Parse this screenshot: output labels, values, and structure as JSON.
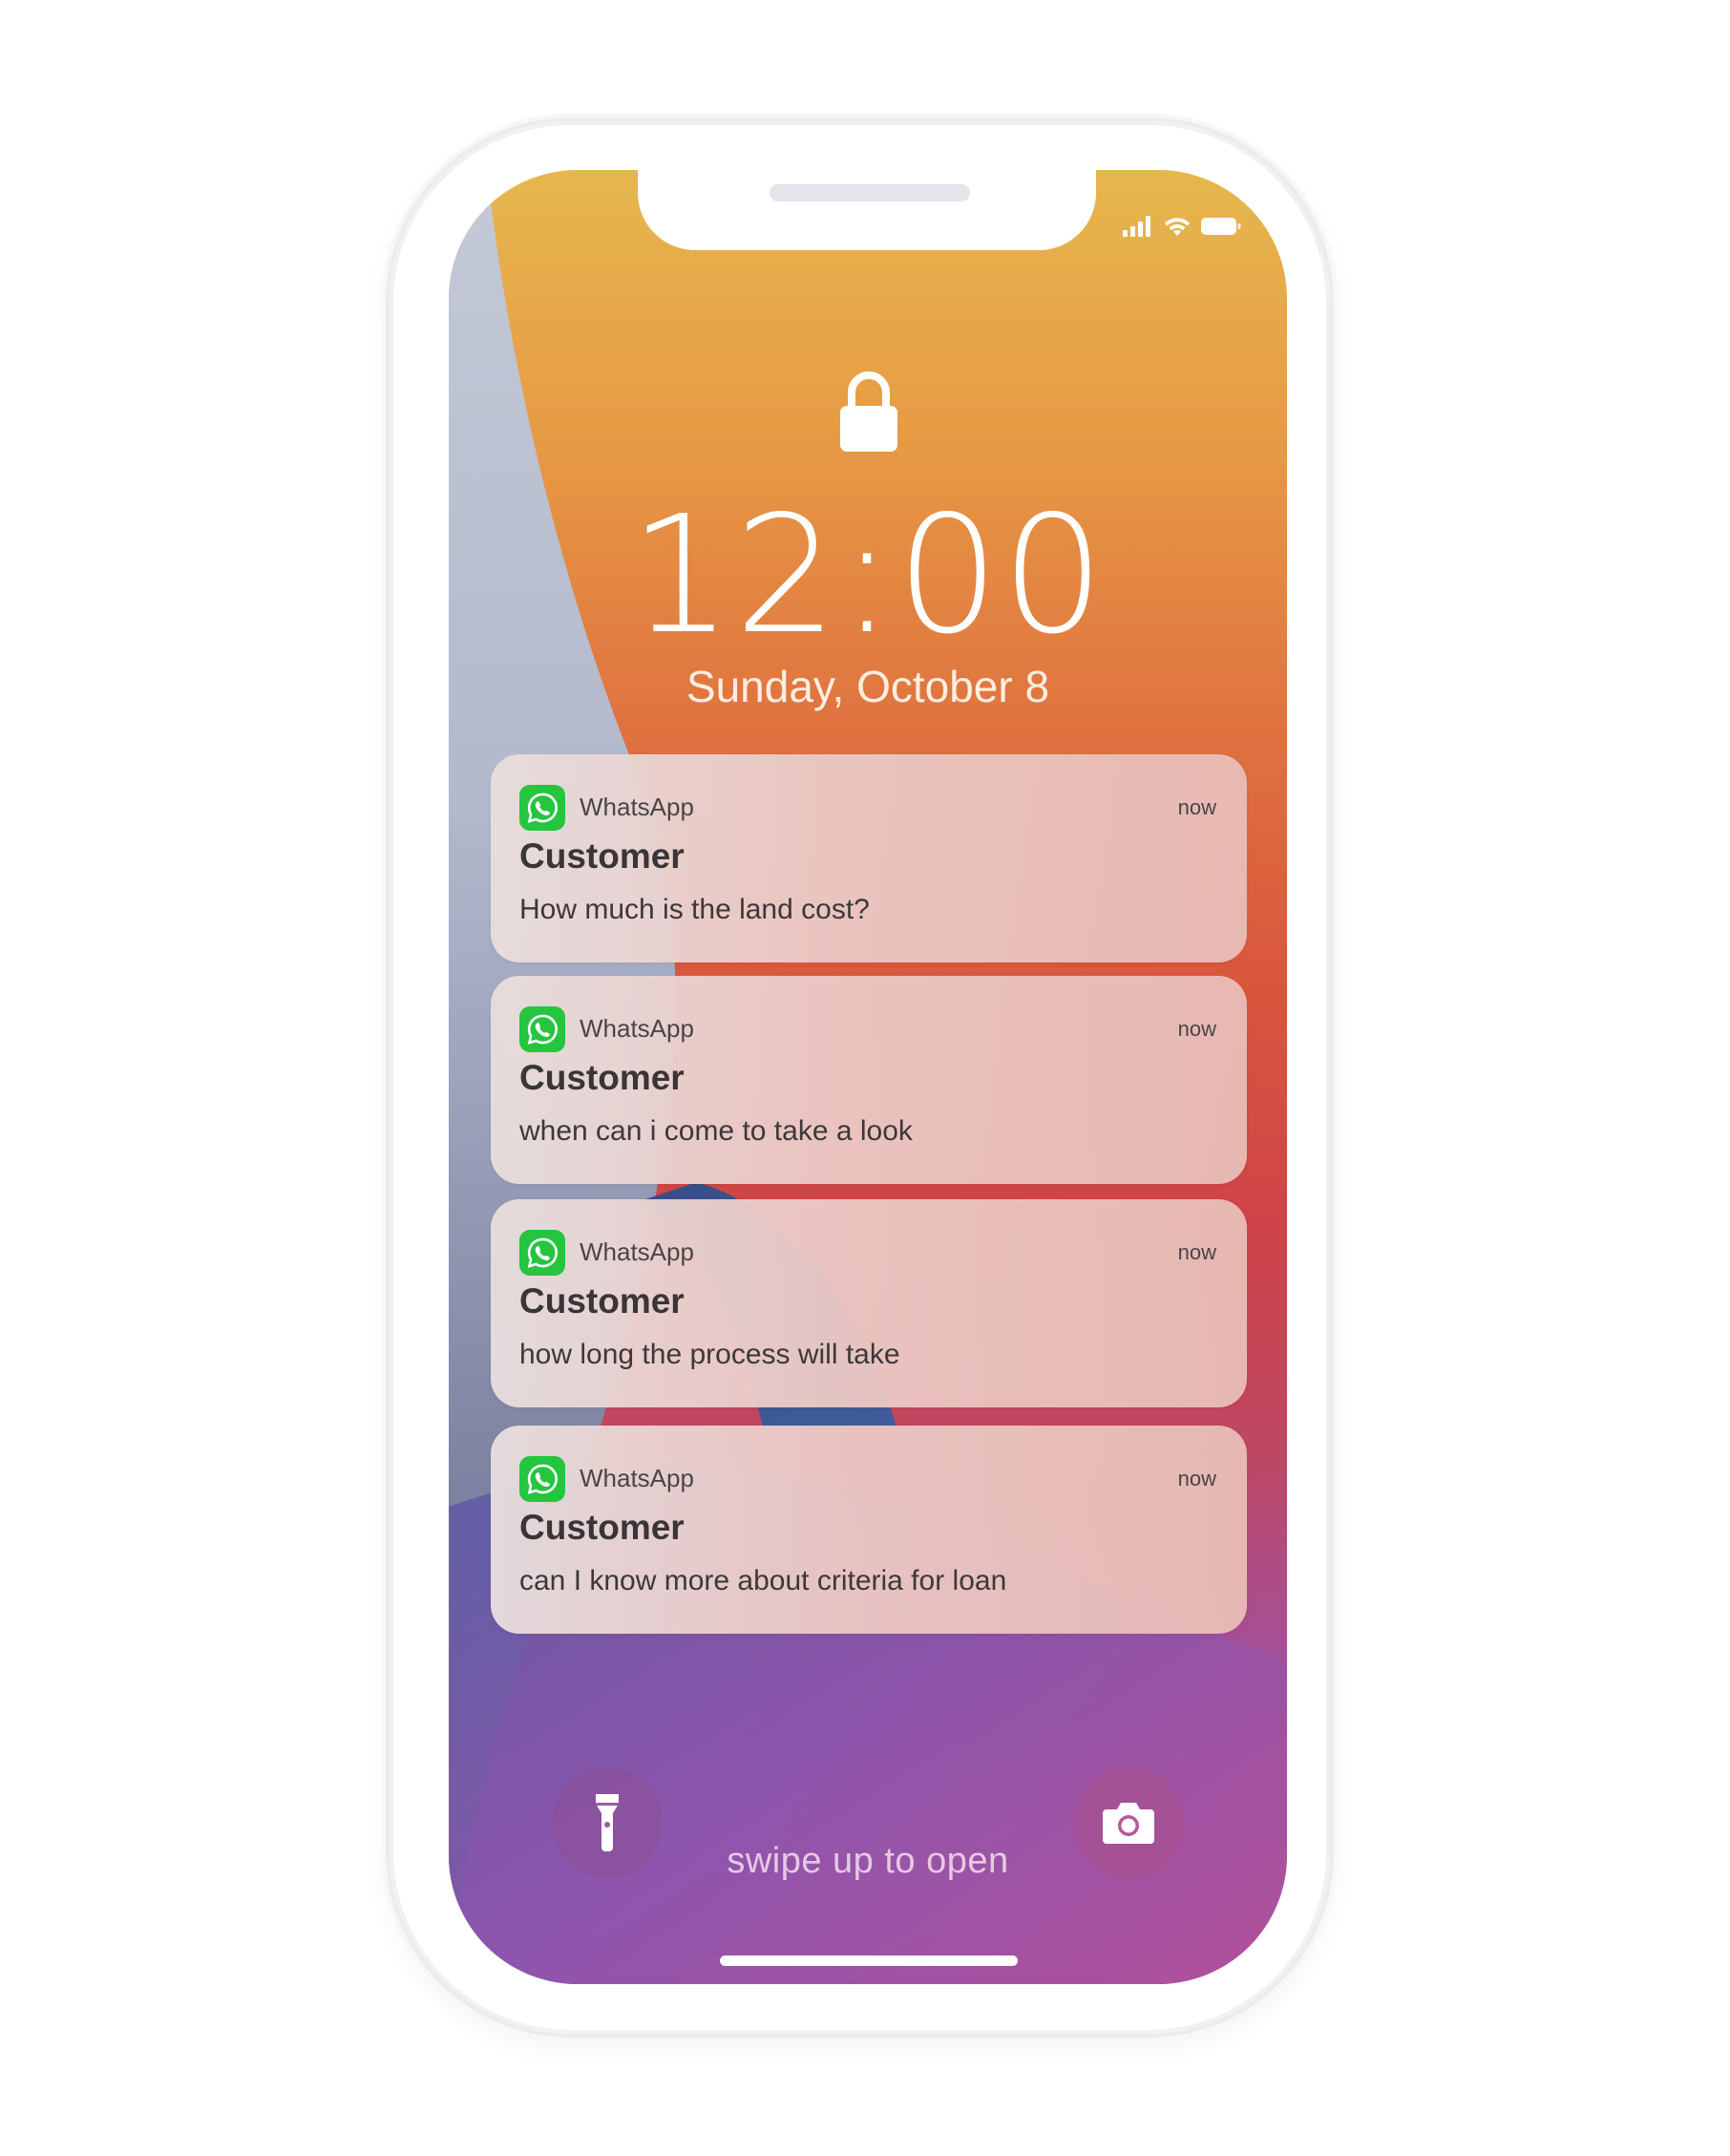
{
  "status_bar": {
    "icons": [
      "signal-icon",
      "wifi-icon",
      "battery-icon"
    ]
  },
  "lock_screen": {
    "lock_icon": "lock-icon",
    "time": "12:00",
    "date": "Sunday, October 8"
  },
  "notifications": [
    {
      "app": "WhatsApp",
      "time": "now",
      "title": "Customer",
      "body": "How much is the land cost?"
    },
    {
      "app": "WhatsApp",
      "time": "now",
      "title": "Customer",
      "body": "when can i come to take a look"
    },
    {
      "app": "WhatsApp",
      "time": "now",
      "title": "Customer",
      "body": "how long the process will take"
    },
    {
      "app": "WhatsApp",
      "time": "now",
      "title": "Customer",
      "body": "can I know more about criteria for loan"
    }
  ],
  "bottom": {
    "flashlight_icon": "flashlight-icon",
    "camera_icon": "camera-icon",
    "swipe_text": "swipe up to open"
  },
  "colors": {
    "whatsapp_green": "#25c540",
    "frame": "#ffffff"
  }
}
